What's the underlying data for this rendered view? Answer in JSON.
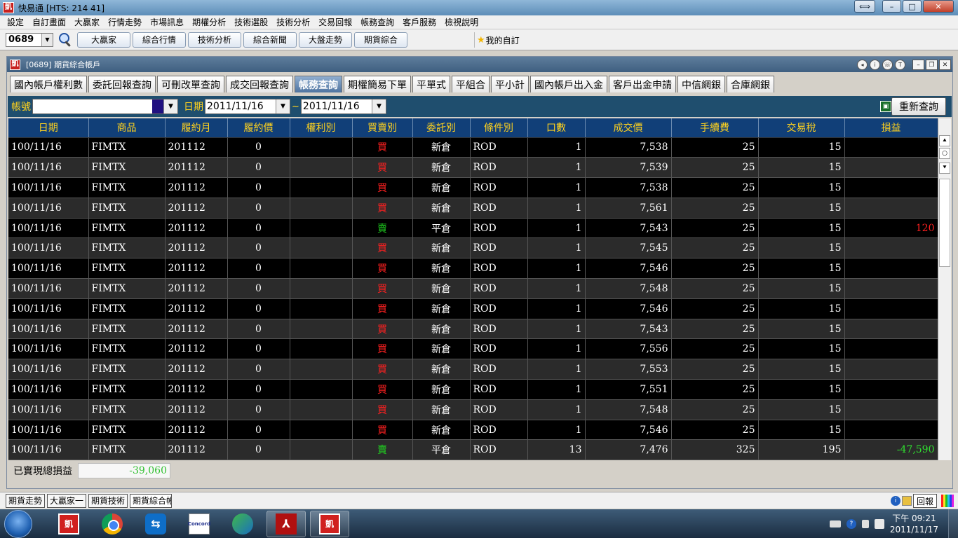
{
  "app": {
    "title": "快易通 [HTS: 214 41]",
    "icon_char": "凱"
  },
  "window_controls": {
    "swap": "⟺",
    "min": "–",
    "max": "□",
    "close": "✕"
  },
  "menu": [
    "設定",
    "自訂畫面",
    "大贏家",
    "行情走勢",
    "市場訊息",
    "期權分析",
    "技術選股",
    "技術分析",
    "交易回報",
    "帳務查詢",
    "客戶服務",
    "檢視說明"
  ],
  "toolbar": {
    "stock_code": "0689",
    "buttons": [
      "大贏家",
      "綜合行情",
      "技術分析",
      "綜合新聞",
      "大盤走勢",
      "期貨綜合"
    ],
    "favorites_label": "我的自訂"
  },
  "inner_window": {
    "title": "[0689] 期貨綜合帳戶",
    "controls": {
      "c1": "◂",
      "c2": "i",
      "c3": "☏",
      "c4": "T",
      "min": "–",
      "restore": "❐",
      "close": "✕"
    }
  },
  "tabs": [
    {
      "label": "國內帳戶權利數",
      "active": false
    },
    {
      "label": "委託回報查詢",
      "active": false
    },
    {
      "label": "可刪改單查詢",
      "active": false
    },
    {
      "label": "成交回報查詢",
      "active": false
    },
    {
      "label": "帳務查詢",
      "active": true
    },
    {
      "label": "期權簡易下單",
      "active": false
    },
    {
      "label": "平單式",
      "active": false
    },
    {
      "label": "平組合",
      "active": false
    },
    {
      "label": "平小計",
      "active": false
    },
    {
      "label": "國內帳戶出入金",
      "active": false
    },
    {
      "label": "客戶出金申請",
      "active": false
    },
    {
      "label": "中信網銀",
      "active": false
    },
    {
      "label": "合庫網銀",
      "active": false
    }
  ],
  "filter": {
    "account_label": "帳號",
    "account_value": "",
    "date_label": "日期",
    "date_from": "2011/11/16",
    "separator": "~",
    "date_to": "2011/11/16",
    "requery_label": "重新查詢"
  },
  "table": {
    "columns": [
      "日期",
      "商品",
      "履約月",
      "履約價",
      "權利別",
      "買賣別",
      "委託別",
      "條件別",
      "口數",
      "成交價",
      "手續費",
      "交易稅",
      "損益"
    ],
    "rows": [
      [
        "100/11/16",
        "FIMTX",
        "201112",
        "0",
        "",
        "買",
        "新倉",
        "ROD",
        "1",
        "7,538",
        "25",
        "15",
        ""
      ],
      [
        "100/11/16",
        "FIMTX",
        "201112",
        "0",
        "",
        "買",
        "新倉",
        "ROD",
        "1",
        "7,539",
        "25",
        "15",
        ""
      ],
      [
        "100/11/16",
        "FIMTX",
        "201112",
        "0",
        "",
        "買",
        "新倉",
        "ROD",
        "1",
        "7,538",
        "25",
        "15",
        ""
      ],
      [
        "100/11/16",
        "FIMTX",
        "201112",
        "0",
        "",
        "買",
        "新倉",
        "ROD",
        "1",
        "7,561",
        "25",
        "15",
        ""
      ],
      [
        "100/11/16",
        "FIMTX",
        "201112",
        "0",
        "",
        "賣",
        "平倉",
        "ROD",
        "1",
        "7,543",
        "25",
        "15",
        "120"
      ],
      [
        "100/11/16",
        "FIMTX",
        "201112",
        "0",
        "",
        "買",
        "新倉",
        "ROD",
        "1",
        "7,545",
        "25",
        "15",
        ""
      ],
      [
        "100/11/16",
        "FIMTX",
        "201112",
        "0",
        "",
        "買",
        "新倉",
        "ROD",
        "1",
        "7,546",
        "25",
        "15",
        ""
      ],
      [
        "100/11/16",
        "FIMTX",
        "201112",
        "0",
        "",
        "買",
        "新倉",
        "ROD",
        "1",
        "7,548",
        "25",
        "15",
        ""
      ],
      [
        "100/11/16",
        "FIMTX",
        "201112",
        "0",
        "",
        "買",
        "新倉",
        "ROD",
        "1",
        "7,546",
        "25",
        "15",
        ""
      ],
      [
        "100/11/16",
        "FIMTX",
        "201112",
        "0",
        "",
        "買",
        "新倉",
        "ROD",
        "1",
        "7,543",
        "25",
        "15",
        ""
      ],
      [
        "100/11/16",
        "FIMTX",
        "201112",
        "0",
        "",
        "買",
        "新倉",
        "ROD",
        "1",
        "7,556",
        "25",
        "15",
        ""
      ],
      [
        "100/11/16",
        "FIMTX",
        "201112",
        "0",
        "",
        "買",
        "新倉",
        "ROD",
        "1",
        "7,553",
        "25",
        "15",
        ""
      ],
      [
        "100/11/16",
        "FIMTX",
        "201112",
        "0",
        "",
        "買",
        "新倉",
        "ROD",
        "1",
        "7,551",
        "25",
        "15",
        ""
      ],
      [
        "100/11/16",
        "FIMTX",
        "201112",
        "0",
        "",
        "買",
        "新倉",
        "ROD",
        "1",
        "7,548",
        "25",
        "15",
        ""
      ],
      [
        "100/11/16",
        "FIMTX",
        "201112",
        "0",
        "",
        "買",
        "新倉",
        "ROD",
        "1",
        "7,546",
        "25",
        "15",
        ""
      ],
      [
        "100/11/16",
        "FIMTX",
        "201112",
        "0",
        "",
        "賣",
        "平倉",
        "ROD",
        "13",
        "7,476",
        "325",
        "195",
        "-47,590"
      ]
    ]
  },
  "scrollbar": {
    "top": "⯅",
    "circle": "○",
    "bottom": "⯆"
  },
  "total": {
    "label": "已實現總損益",
    "value": "-39,060"
  },
  "task_strip": {
    "buttons": [
      "期貨走勢",
      "大贏家一",
      "期貨技術",
      "期貨綜合帳戶"
    ],
    "report_label": "回報"
  },
  "taskbar": {
    "apps": [
      {
        "name": "hts",
        "label": "凱"
      },
      {
        "name": "chrome",
        "label": ""
      },
      {
        "name": "teamviewer",
        "label": "⇆"
      },
      {
        "name": "concord",
        "label": "Concord"
      },
      {
        "name": "messenger",
        "label": ""
      },
      {
        "name": "pdf",
        "label": "⅄"
      },
      {
        "name": "hts-active",
        "label": "凱"
      }
    ],
    "clock_time": "下午 09:21",
    "clock_date": "2011/11/17"
  },
  "colors": {
    "grid_header_text": "#ffd21e",
    "buy": "#ff2020",
    "sell": "#20d020",
    "filter_bg": "#1f4e6e"
  }
}
